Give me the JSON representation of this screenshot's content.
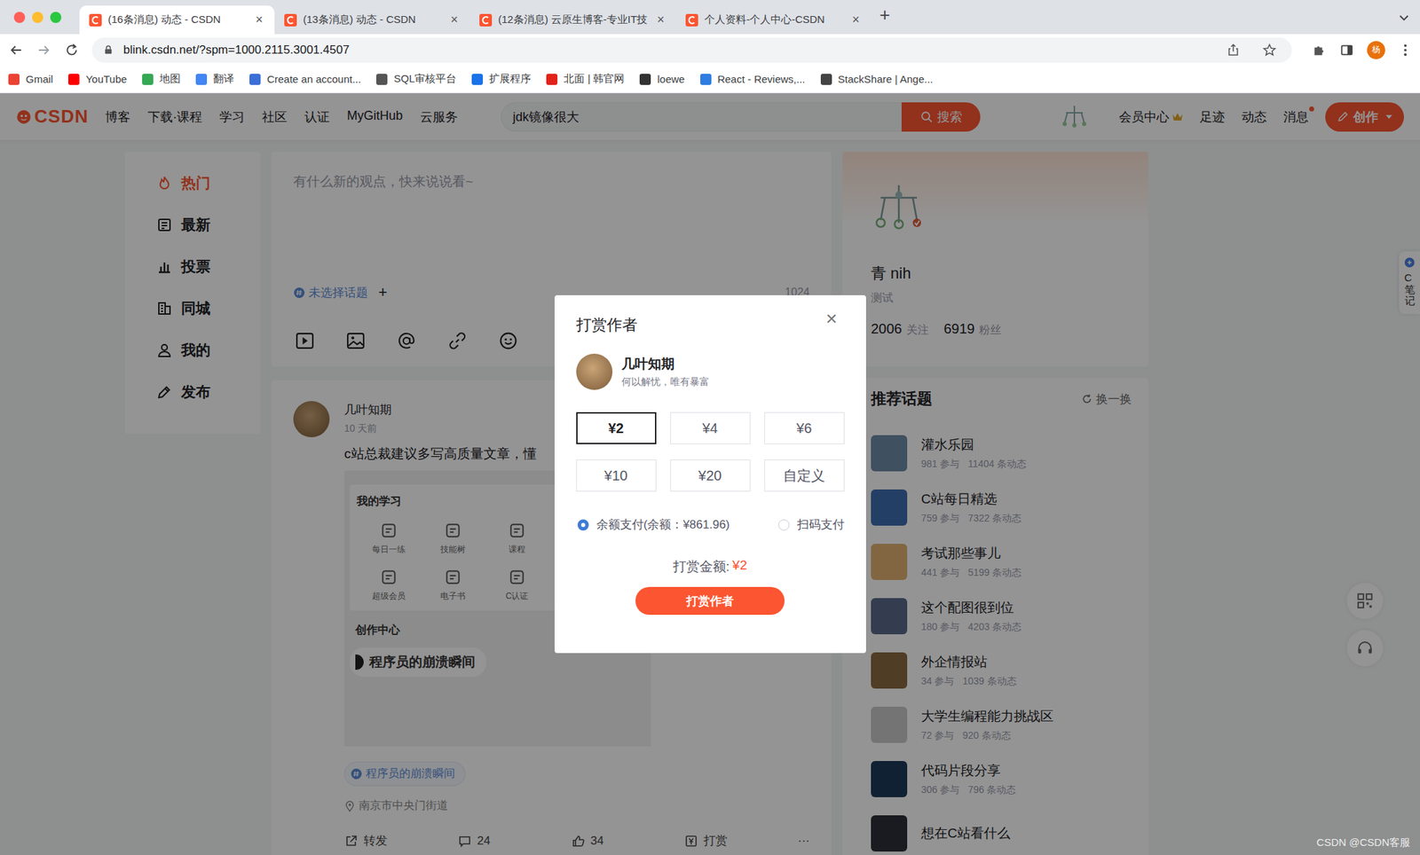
{
  "browser": {
    "tabs": [
      {
        "label": "(16条消息) 动态 - CSDN",
        "selected": true
      },
      {
        "label": "(13条消息) 动态 - CSDN",
        "selected": false
      },
      {
        "label": "(12条消息) 云原生博客-专业IT技",
        "selected": false
      },
      {
        "label": "个人资料-个人中心-CSDN",
        "selected": false
      }
    ],
    "tab_close": "×",
    "new_tab": "+",
    "url": "blink.csdn.net/?spm=1000.2115.3001.4507",
    "profile_initial": "杨",
    "bookmarks": [
      {
        "label": "Gmail",
        "color": "#ea4335"
      },
      {
        "label": "YouTube",
        "color": "#ff0000"
      },
      {
        "label": "地图",
        "color": "#34a853"
      },
      {
        "label": "翻译",
        "color": "#4285f4"
      },
      {
        "label": "Create an account...",
        "color": "#3b6fd8"
      },
      {
        "label": "SQL审核平台",
        "color": "#555555"
      },
      {
        "label": "扩展程序",
        "color": "#1a73e8"
      },
      {
        "label": "北面 | 韩官网",
        "color": "#e2231a"
      },
      {
        "label": "loewe",
        "color": "#333333"
      },
      {
        "label": "React - Reviews,...",
        "color": "#2f7de1"
      },
      {
        "label": "StackShare | Ange...",
        "color": "#444444"
      }
    ]
  },
  "header": {
    "logo": "CSDN",
    "nav": [
      "博客",
      "下载·课程",
      "学习",
      "社区",
      "认证",
      "MyGitHub",
      "云服务"
    ],
    "search": {
      "value": "jdk镜像很大",
      "button": "搜索"
    },
    "links": [
      {
        "label": "会员中心",
        "kind": "vip",
        "unread": false
      },
      {
        "label": "足迹",
        "kind": "plain",
        "unread": false
      },
      {
        "label": "动态",
        "kind": "plain",
        "unread": false
      },
      {
        "label": "消息",
        "kind": "plain",
        "unread": true
      }
    ],
    "create": "创作"
  },
  "sidebar": {
    "items": [
      {
        "label": "热门",
        "kind": "hot",
        "selected": true
      },
      {
        "label": "最新",
        "kind": "new",
        "selected": false
      },
      {
        "label": "投票",
        "kind": "vote",
        "selected": false
      },
      {
        "label": "同城",
        "kind": "city",
        "selected": false
      },
      {
        "label": "我的",
        "kind": "mine",
        "selected": false
      },
      {
        "label": "发布",
        "kind": "publish",
        "selected": false
      }
    ]
  },
  "composer": {
    "placeholder": "有什么新的观点，快来说说看~",
    "topic": "未选择话题",
    "topic_add": "+",
    "limit": "1024"
  },
  "post": {
    "author": "几叶知期",
    "time": "10 天前",
    "text": "c站总裁建议多写高质量文章，懂",
    "image": {
      "section": "我的学习",
      "items": [
        "每日一练",
        "技能树",
        "课程",
        "超级会员",
        "电子书",
        "C认证"
      ],
      "section2": "创作中心",
      "banner": "程序员的崩溃瞬间"
    },
    "topic": "程序员的崩溃瞬间",
    "location": "南京市中央门街道",
    "actions": [
      {
        "label": "转发",
        "kind": "share"
      },
      {
        "label": "24",
        "kind": "comment"
      },
      {
        "label": "34",
        "kind": "like"
      },
      {
        "label": "打赏",
        "kind": "reward"
      },
      {
        "label": "···",
        "kind": "more"
      }
    ]
  },
  "profile": {
    "name": "青 nih",
    "bio": "测试",
    "stats": [
      {
        "value": "2006",
        "label": "关注"
      },
      {
        "value": "6919",
        "label": "粉丝"
      }
    ]
  },
  "topics": {
    "title": "推荐话题",
    "refresh": "换一换",
    "items": [
      {
        "name": "灌水乐园",
        "joined": "981 参与",
        "posts": "11404 条动态",
        "color": "#6d8aa6"
      },
      {
        "name": "C站每日精选",
        "joined": "759 参与",
        "posts": "7322 条动态",
        "color": "#3e6db0"
      },
      {
        "name": "考试那些事儿",
        "joined": "441 参与",
        "posts": "5199 条动态",
        "color": "#e0b070"
      },
      {
        "name": "这个配图很到位",
        "joined": "180 参与",
        "posts": "4203 条动态",
        "color": "#5a6a8a"
      },
      {
        "name": "外企情报站",
        "joined": "34 参与",
        "posts": "1039 条动态",
        "color": "#8a6a40"
      },
      {
        "name": "大学生编程能力挑战区",
        "joined": "72 参与",
        "posts": "920 条动态",
        "color": "#c8c8c8"
      },
      {
        "name": "代码片段分享",
        "joined": "306 参与",
        "posts": "796 条动态",
        "color": "#1e3a5a"
      },
      {
        "name": "想在C站看什么",
        "color": "#2b2f3a"
      }
    ]
  },
  "float": {
    "note": "C笔记"
  },
  "watermark": "CSDN @CSDN客服",
  "modal": {
    "title": "打赏作者",
    "close": "×",
    "author": "几叶知期",
    "motto": "何以解忧，唯有暴富",
    "amounts": [
      {
        "label": "¥2",
        "selected": true
      },
      {
        "label": "¥4",
        "selected": false
      },
      {
        "label": "¥6",
        "selected": false
      },
      {
        "label": "¥10",
        "selected": false
      },
      {
        "label": "¥20",
        "selected": false
      },
      {
        "label": "自定义",
        "selected": false
      }
    ],
    "payments": [
      {
        "label": "余额支付(余额：¥861.96)",
        "selected": true
      },
      {
        "label": "扫码支付",
        "selected": false
      }
    ],
    "total_label": "打赏金额:",
    "total": "¥2",
    "submit": "打赏作者"
  }
}
